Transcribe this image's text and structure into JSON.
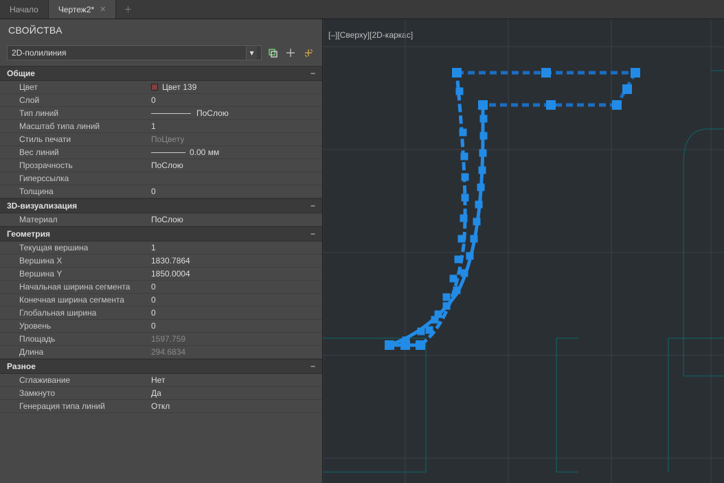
{
  "tabs": [
    {
      "label": "Начало",
      "active": false,
      "closable": false
    },
    {
      "label": "Чертеж2*",
      "active": true,
      "closable": true
    }
  ],
  "panel_title": "СВОЙСТВА",
  "selector_value": "2D-полилиния",
  "sections": {
    "general": {
      "title": "Общие",
      "color_label": "Цвет",
      "color_value": "Цвет 139",
      "layer_label": "Слой",
      "layer_value": "0",
      "linetype_label": "Тип линий",
      "linetype_value": "ПоСлою",
      "ltscale_label": "Масштаб типа линий",
      "ltscale_value": "1",
      "plotstyle_label": "Стиль печати",
      "plotstyle_value": "ПоЦвету",
      "lineweight_label": "Вес линий",
      "lineweight_value": "0.00 мм",
      "transparency_label": "Прозрачность",
      "transparency_value": "ПоСлою",
      "hyperlink_label": "Гиперссылка",
      "hyperlink_value": "",
      "thickness_label": "Толщина",
      "thickness_value": "0"
    },
    "viz3d": {
      "title": "3D-визуализация",
      "material_label": "Материал",
      "material_value": "ПоСлою"
    },
    "geometry": {
      "title": "Геометрия",
      "cur_vertex_label": "Текущая вершина",
      "cur_vertex_value": "1",
      "vx_label": "Вершина X",
      "vx_value": "1830.7864",
      "vy_label": "Вершина Y",
      "vy_value": "1850.0004",
      "start_w_label": "Начальная ширина сегмента",
      "start_w_value": "0",
      "end_w_label": "Конечная ширина сегмента",
      "end_w_value": "0",
      "global_w_label": "Глобальная ширина",
      "global_w_value": "0",
      "elev_label": "Уровень",
      "elev_value": "0",
      "area_label": "Площадь",
      "area_value": "1597.759",
      "length_label": "Длина",
      "length_value": "294.6834"
    },
    "misc": {
      "title": "Разное",
      "fit_label": "Сглаживание",
      "fit_value": "Нет",
      "closed_label": "Замкнуто",
      "closed_value": "Да",
      "ltgen_label": "Генерация типа линий",
      "ltgen_value": "Откл"
    }
  },
  "viewport": {
    "label_minus": "[–]",
    "label_view": "[Сверху]",
    "label_style": "[2D-каркас]"
  }
}
